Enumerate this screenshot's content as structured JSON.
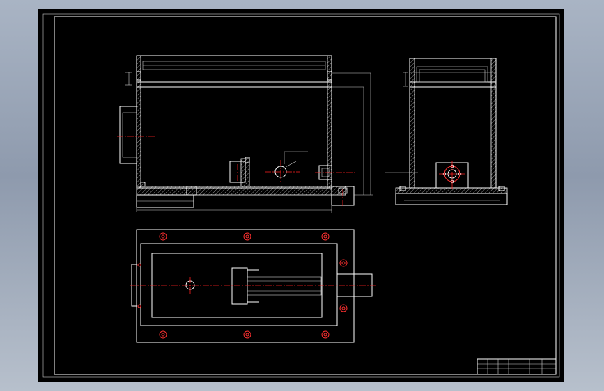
{
  "window": {
    "background_color": "#000000",
    "line_color": "#ffffff",
    "centerline_color": "#ff2020"
  },
  "title_block": {
    "cells": [
      "",
      "",
      "",
      "",
      "",
      "",
      ""
    ]
  }
}
